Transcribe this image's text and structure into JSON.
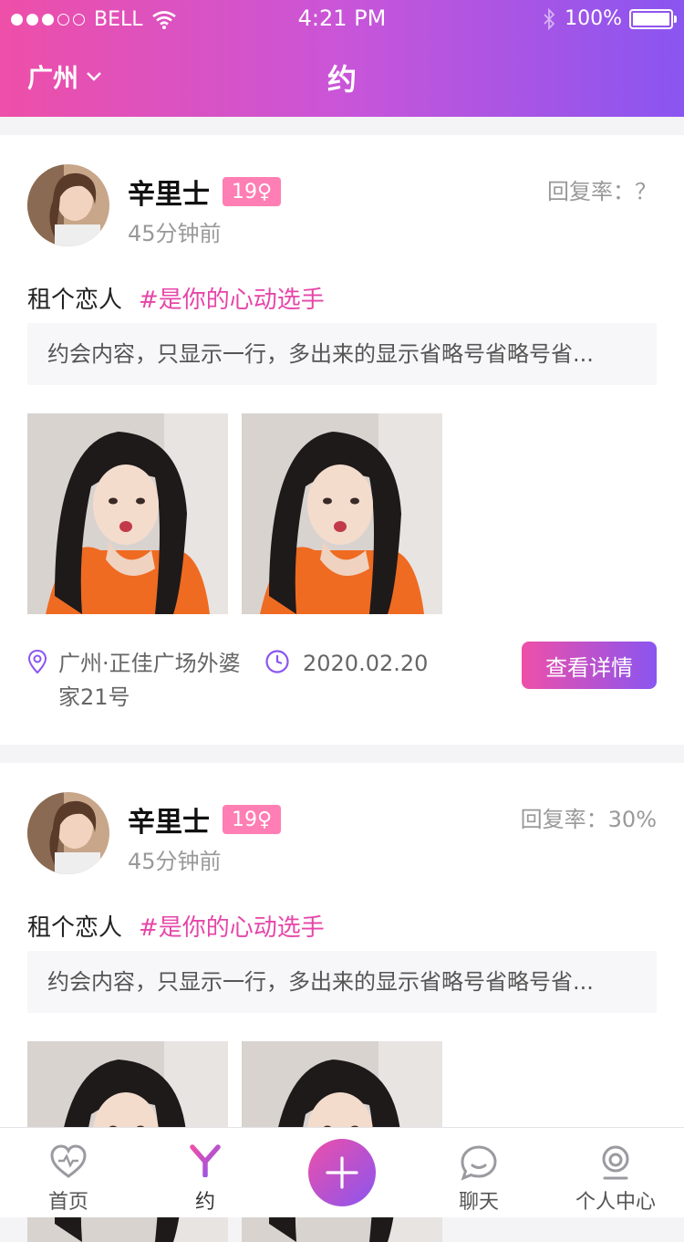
{
  "status_bar": {
    "carrier": "BELL",
    "time": "4:21 PM",
    "battery": "100%"
  },
  "nav": {
    "city": "广州",
    "title": "约"
  },
  "posts": [
    {
      "user_name": "辛里士",
      "age_badge": "19♀",
      "posted": "45分钟前",
      "reply_rate": "回复率：？",
      "title": "租个恋人",
      "topic": "#是你的心动选手",
      "content": "约会内容，只显示一行，多出来的显示省略号省略号省...",
      "location": "广州·正佳广场外婆家21号",
      "date": "2020.02.20",
      "detail_button": "查看详情"
    },
    {
      "user_name": "辛里士",
      "age_badge": "19♀",
      "posted": "45分钟前",
      "reply_rate": "回复率：30%",
      "title": "租个恋人",
      "topic": "#是你的心动选手",
      "content": "约会内容，只显示一行，多出来的显示省略号省略号省..."
    }
  ],
  "tab_bar": {
    "home": "首页",
    "yue": "约",
    "chat": "聊天",
    "me": "个人中心"
  },
  "colors": {
    "gradient_start": "#ee4fa8",
    "gradient_end": "#8a55f0",
    "tag_pink": "#e646a8",
    "age_badge": "#ff7eb3"
  }
}
